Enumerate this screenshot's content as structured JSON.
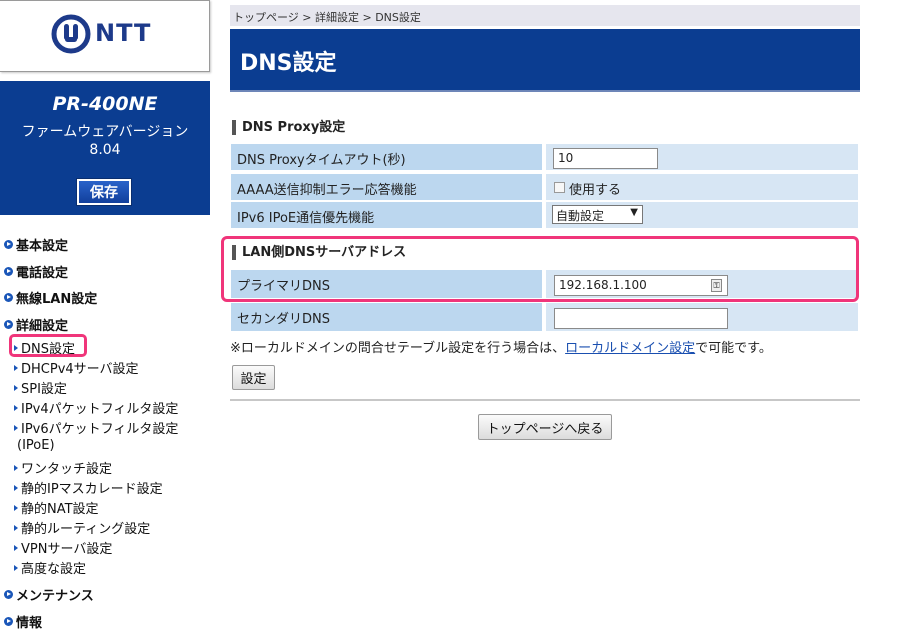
{
  "logo": {
    "text": "NTT"
  },
  "device": {
    "model": "PR-400NE",
    "firmware_label": "ファームウェアバージョン",
    "firmware_version": "8.04",
    "save_label": "保存"
  },
  "sidebar": {
    "sections": [
      {
        "label": "基本設定"
      },
      {
        "label": "電話設定"
      },
      {
        "label": "無線LAN設定"
      },
      {
        "label": "詳細設定"
      }
    ],
    "sub_items": [
      "DNS設定",
      "DHCPv4サーバ設定",
      "SPI設定",
      "IPv4パケットフィルタ設定",
      "IPv6パケットフィルタ設定",
      "(IPoE)",
      "ワンタッチ設定",
      "静的IPマスカレード設定",
      "静的NAT設定",
      "静的ルーティング設定",
      "VPNサーバ設定",
      "高度な設定"
    ],
    "bottom_sections": [
      {
        "label": "メンテナンス"
      },
      {
        "label": "情報"
      }
    ]
  },
  "breadcrumb": "トップページ > 詳細設定 > DNS設定",
  "page_title": "DNS設定",
  "dns_proxy": {
    "heading": "DNS Proxy設定",
    "timeout_label": "DNS Proxyタイムアウト(秒)",
    "timeout_value": "10",
    "aaaa_label": "AAAA送信抑制エラー応答機能",
    "aaaa_option": "使用する",
    "ipv6_label": "IPv6 IPoE通信優先機能",
    "ipv6_value": "自動設定"
  },
  "lan_dns": {
    "heading": "LAN側DNSサーバアドレス",
    "primary_label": "プライマリDNS",
    "primary_value": "192.168.1.100",
    "secondary_label": "セカンダリDNS",
    "secondary_value": ""
  },
  "note": {
    "prefix": "※ローカルドメインの問合せテーブル設定を行う場合は、",
    "link": "ローカルドメイン設定",
    "suffix": "で可能です。"
  },
  "buttons": {
    "apply": "設定",
    "back": "トップページへ戻る"
  },
  "colors": {
    "brand_blue": "#0b3d91",
    "highlight_pink": "#f0357a",
    "label_cell": "#bcd7ef",
    "value_cell": "#d7e6f4"
  }
}
